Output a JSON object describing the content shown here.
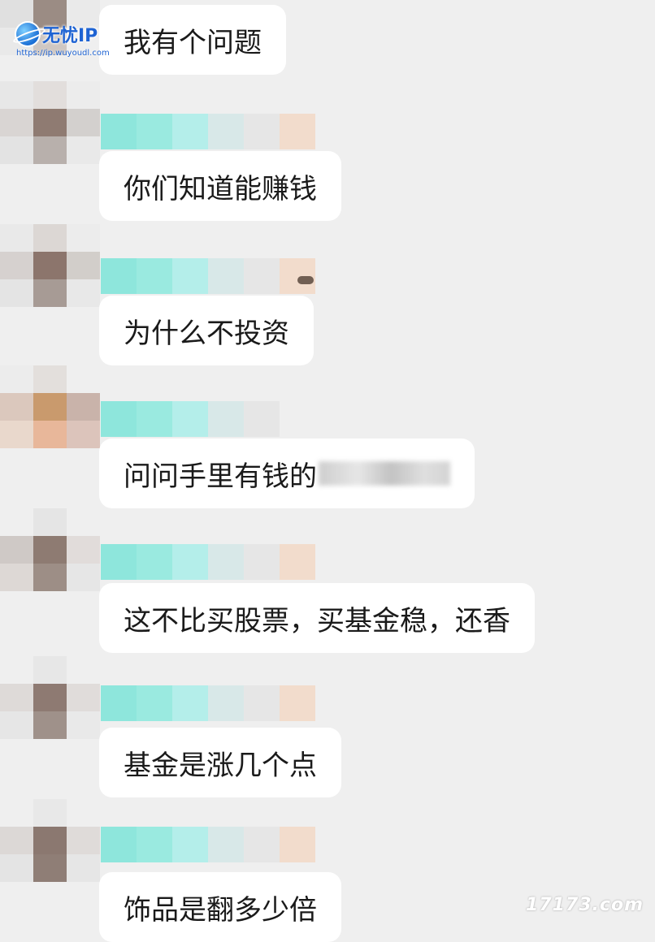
{
  "watermark": {
    "title": "无忧IP",
    "url": "https://ip.wuyoudl.com",
    "bottom": "17173.com"
  },
  "messages": [
    {
      "text": "我有个问题"
    },
    {
      "text": "你们知道能赚钱"
    },
    {
      "text": "为什么不投资"
    },
    {
      "text": "问问手里有钱的"
    },
    {
      "text": "这不比买股票，买基金稳，还香"
    },
    {
      "text": "基金是涨几个点"
    },
    {
      "text": "饰品是翻多少倍"
    }
  ],
  "colors": {
    "background": "#efefef",
    "bubble": "#ffffff",
    "name_redaction": [
      "#8ee6dc",
      "#9aeae0",
      "#b4eeea",
      "#d8e8e8",
      "#e6e6e6",
      "#f2dccc"
    ]
  }
}
